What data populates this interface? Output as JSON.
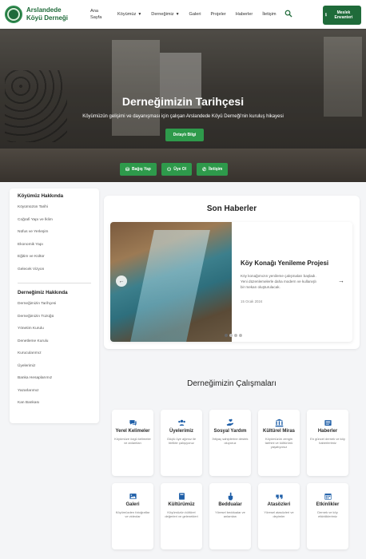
{
  "brand": {
    "name": "Arslandede Köyü Derneği"
  },
  "nav": {
    "items": [
      {
        "label": "Ana Sayfa",
        "caret": false
      },
      {
        "label": "Köyümüz",
        "caret": true
      },
      {
        "label": "Derneğimiz",
        "caret": true
      },
      {
        "label": "Galeri",
        "caret": false
      },
      {
        "label": "Projeler",
        "caret": false
      },
      {
        "label": "Haberler",
        "caret": false
      },
      {
        "label": "İletişim",
        "caret": false
      }
    ],
    "member_button": "Meslek Envanteri"
  },
  "hero": {
    "title": "Derneğimizin Tarihçesi",
    "subtitle": "Köyümüzün gelişimi ve dayanışması için çalışan Arslandede Köyü Derneği'nin kuruluş hikayesi",
    "button": "Detaylı Bilgi",
    "quick": [
      {
        "label": "Bağış Yap",
        "icon": "donate-icon"
      },
      {
        "label": "Üye Ol",
        "icon": "users-icon"
      },
      {
        "label": "İletişim",
        "icon": "phone-icon"
      }
    ]
  },
  "sidebar": {
    "section1": {
      "title": "Köyümüz Hakkında",
      "items": [
        "Köyümüzün Tarihi",
        "Coğrafi Yapı ve İklim",
        "Nüfus ve Yerleşim",
        "Ekonomik Yapı",
        "Eğitim ve Kültür",
        "Gelecek Vizyon"
      ]
    },
    "section2": {
      "title": "Derneğimiz Hakkında",
      "items": [
        "Derneğimizin Tarihçesi",
        "Derneğimizin Tüzüğü",
        "Yönetim Kurulu",
        "Denetleme Kurulu",
        "Kurucularımız",
        "Üyelerimiz",
        "Banka Hesaplarımız",
        "Yazarlarımız",
        "Kan Bankası"
      ]
    }
  },
  "news": {
    "title": "Son Haberler",
    "item": {
      "headline": "Köy Konağı Yenileme Projesi",
      "text_line1": "Köy konağımızın yenileme çalışmaları başladı.",
      "text_line2": "Yeni düzenlemelerle daha modern ve kullanışlı",
      "text_line3": "bir mekan oluşturulacak.",
      "date": "15 Ocak 2024"
    },
    "slides": 4,
    "active_slide": 1
  },
  "works": {
    "title": "Derneğimizin Çalışmaları",
    "cards": [
      {
        "title": "Yerel Kelimeler",
        "desc": "Köyümüze özgü kelimeler ve anlamları",
        "icon": "chat-icon"
      },
      {
        "title": "Üyelerimiz",
        "desc": "Güçlü üye ağımız ile birlikte çalışıyoruz",
        "icon": "users-icon"
      },
      {
        "title": "Sosyal Yardım",
        "desc": "İhtiyaç sahiplerine destek oluyoruz",
        "icon": "hand-heart-icon"
      },
      {
        "title": "Kültürel Miras",
        "desc": "Köyümüzün zengin tarihini ve kültürünü yaşatıyoruz",
        "icon": "landmark-icon"
      },
      {
        "title": "Haberler",
        "desc": "En güncel dernek ve köy haberlerimiz",
        "icon": "newspaper-icon"
      },
      {
        "title": "Galeri",
        "desc": "Köyümüzden fotoğraflar ve videolar",
        "icon": "image-icon"
      },
      {
        "title": "Kültürümüz",
        "desc": "Köyümüzün kültürel değerleri ve gelenekleri",
        "icon": "book-icon"
      },
      {
        "title": "Beddualar",
        "desc": "Yöresel beddualar ve anlamları",
        "icon": "hand-point-icon"
      },
      {
        "title": "Atasözleri",
        "desc": "Yöresel atasözleri ve deyimler",
        "icon": "quote-icon"
      },
      {
        "title": "Etkinlikler",
        "desc": "Dernek ve köy etkinliklerimiz",
        "icon": "calendar-icon"
      }
    ]
  },
  "colors": {
    "primary": "#1f6b3a",
    "accent": "#2e9a4b",
    "background": "#f4f5f7"
  }
}
